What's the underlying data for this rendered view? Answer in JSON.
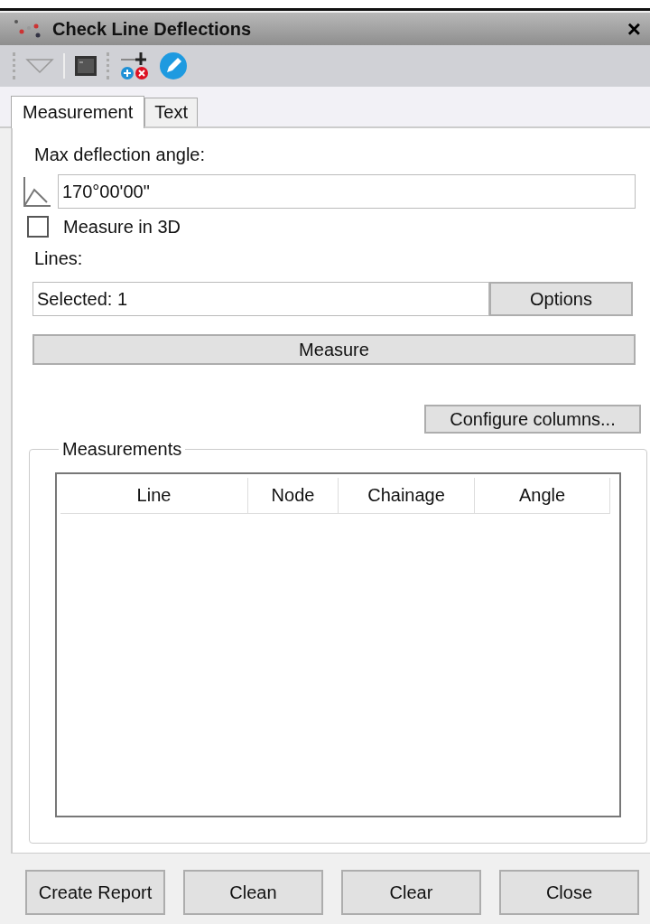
{
  "window": {
    "title": "Check Line Deflections",
    "close": "×"
  },
  "tabs": [
    {
      "label": "Measurement",
      "selected": true
    },
    {
      "label": "Text",
      "selected": false
    }
  ],
  "max_angle": {
    "label": "Max deflection angle:",
    "value": "170°00'00\""
  },
  "measure_3d": {
    "label": "Measure in 3D",
    "checked": false
  },
  "lines": {
    "label": "Lines:",
    "value": "Selected: 1",
    "options_button": "Options"
  },
  "measure_button": "Measure",
  "configure_button": "Configure columns...",
  "measurements": {
    "title": "Measurements",
    "columns": [
      "Line",
      "Node",
      "Chainage",
      "Angle"
    ]
  },
  "buttons": [
    "Create Report",
    "Clean",
    "Clear",
    "Close"
  ]
}
